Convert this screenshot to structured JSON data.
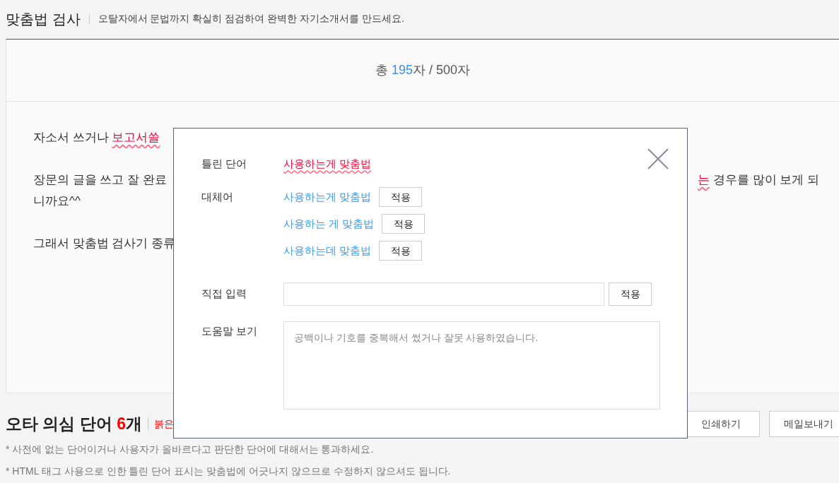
{
  "header": {
    "title": "맞춤법 검사",
    "subtitle": "오탈자에서 문법까지 확실히 점검하여 완벽한 자기소개서를 만드세요."
  },
  "counter": {
    "prefix": "총",
    "count": "195",
    "unit": "자",
    "separator": "/",
    "limit": "500자"
  },
  "paragraphs": [
    {
      "left": [
        {
          "text": "자소서 쓰거나 ",
          "error": false
        },
        {
          "text": "보고서쓸",
          "error": true
        }
      ]
    },
    {
      "left": [
        {
          "text": "장문의 글을 쓰고 잘 완료",
          "error": false
        }
      ],
      "right": [
        {
          "text": "는",
          "error": true
        },
        {
          "text": " 경우를 많이 보게 되",
          "error": false
        }
      ],
      "next_line": "니까요^^"
    },
    {
      "left": [
        {
          "text": "그래서 맞춤법 검사기 종류",
          "error": false
        }
      ]
    }
  ],
  "summary": {
    "title": "오타 의심 단어",
    "count": "6개",
    "hint": "붉은"
  },
  "actions": [
    "인쇄하기",
    "메일보내기"
  ],
  "notes": [
    "* 사전에 없는 단어이거나 사용자가 올바르다고 판단한 단어에 대해서는 통과하세요.",
    "* HTML 태그 사용으로 인한 틀린 단어 표시는 맞춤법에 어긋나지 않으므로 수정하지 않으셔도 됩니다."
  ],
  "popup": {
    "wrong_label": "틀린 단어",
    "wrong_word": "사용하는게 맞춤법",
    "alt_label": "대체어",
    "alternatives": [
      {
        "text": "사용하는게 맞춤법",
        "button": "적용"
      },
      {
        "text": "사용하는 게 맞춤법",
        "button": "적용"
      },
      {
        "text": "사용하는데 맞춤법",
        "button": "적용"
      }
    ],
    "input_label": "직접 입력",
    "input_button": "적용",
    "help_label": "도움말 보기",
    "help_text": "공백이나 기호를 중복해서 썼거나 잘못 사용하였습니다."
  }
}
